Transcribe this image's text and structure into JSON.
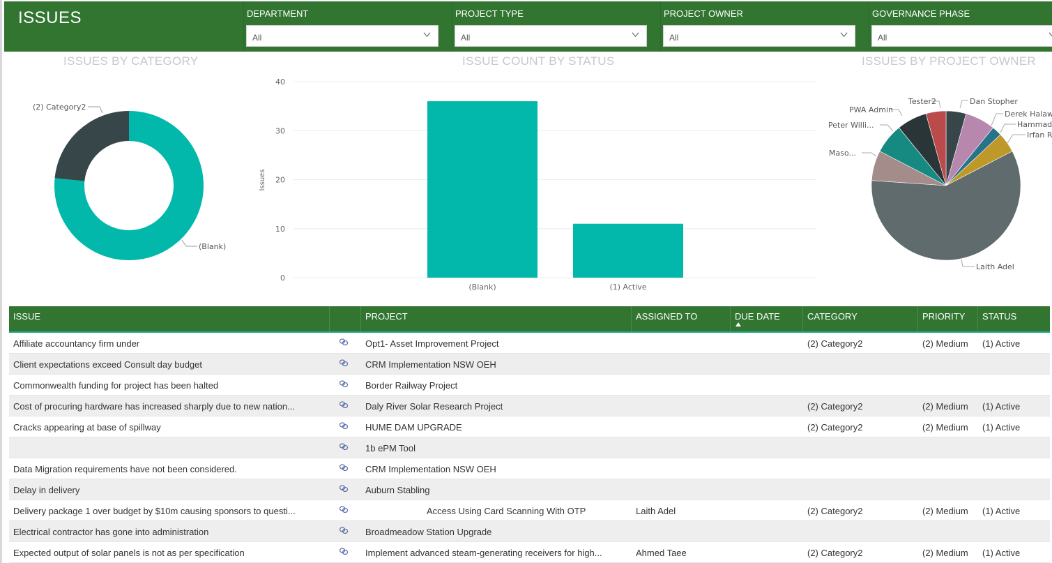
{
  "header": {
    "title": "ISSUES",
    "slicers": [
      {
        "label": "DEPARTMENT",
        "value": "All"
      },
      {
        "label": "PROJECT TYPE",
        "value": "All"
      },
      {
        "label": "PROJECT OWNER",
        "value": "All"
      },
      {
        "label": "GOVERNANCE PHASE",
        "value": "All"
      }
    ]
  },
  "colors": {
    "header_green": "#317531",
    "teal": "#01B8AA",
    "dark_slate": "#374649",
    "title_gray": "#c8c8c8"
  },
  "chart_data": [
    {
      "type": "pie",
      "variant": "donut",
      "title": "ISSUES BY CATEGORY",
      "categories": [
        "(Blank)",
        "(2) Category2"
      ],
      "values": [
        36,
        11
      ],
      "colors": [
        "#01B8AA",
        "#374649"
      ]
    },
    {
      "type": "bar",
      "title": "ISSUE COUNT BY STATUS",
      "categories": [
        "(Blank)",
        "(1) Active"
      ],
      "values": [
        36,
        11
      ],
      "xlabel": "",
      "ylabel": "Issues",
      "ylim": [
        0,
        40
      ],
      "yticks": [
        0,
        10,
        20,
        30,
        40
      ],
      "grid": true,
      "color": "#01B8AA"
    },
    {
      "type": "pie",
      "title": "ISSUES BY PROJECT OWNER",
      "categories": [
        "Dan Stopher",
        "Derek Halaw",
        "Hammad",
        "Irfan R",
        "Laith Adel",
        "Maso...",
        "Peter Willi...",
        "PWA Admin",
        "Tester2"
      ],
      "values": [
        2,
        3,
        1,
        2,
        27,
        3,
        3,
        3,
        2
      ],
      "colors": [
        "#374649",
        "#B887AD",
        "#28738A",
        "#BE9828",
        "#5F6B6D",
        "#A48C8A",
        "#168980",
        "#293537",
        "#BB4A4A"
      ]
    }
  ],
  "table": {
    "columns": [
      "ISSUE",
      "",
      "PROJECT",
      "ASSIGNED TO",
      "DUE DATE",
      "CATEGORY",
      "PRIORITY",
      "STATUS"
    ],
    "sorted_column": "DUE DATE",
    "rows": [
      {
        "issue": "Affiliate accountancy firm under",
        "project": "Opt1- Asset Improvement Project",
        "assigned_to": "",
        "due_date": "",
        "category": "(2) Category2",
        "priority": "(2) Medium",
        "status": "(1) Active"
      },
      {
        "issue": "Client expectations exceed Consult day budget",
        "project": "CRM Implementation NSW OEH",
        "assigned_to": "",
        "due_date": "",
        "category": "",
        "priority": "",
        "status": ""
      },
      {
        "issue": "Commonwealth funding for project has been halted",
        "project": "Border Railway Project",
        "assigned_to": "",
        "due_date": "",
        "category": "",
        "priority": "",
        "status": ""
      },
      {
        "issue": "Cost of procuring hardware has increased sharply due to new nation...",
        "project": "Daly River Solar Research Project",
        "assigned_to": "",
        "due_date": "",
        "category": "(2) Category2",
        "priority": "(2) Medium",
        "status": "(1) Active"
      },
      {
        "issue": "Cracks appearing at base of spillway",
        "project": "HUME DAM UPGRADE",
        "assigned_to": "",
        "due_date": "",
        "category": "(2) Category2",
        "priority": "(2) Medium",
        "status": "(1) Active"
      },
      {
        "issue": "",
        "project": "1b ePM Tool",
        "assigned_to": "",
        "due_date": "",
        "category": "",
        "priority": "",
        "status": ""
      },
      {
        "issue": "Data Migration requirements have not been considered.",
        "project": "CRM Implementation NSW OEH",
        "assigned_to": "",
        "due_date": "",
        "category": "",
        "priority": "",
        "status": ""
      },
      {
        "issue": "Delay in delivery",
        "project": "Auburn Stabling",
        "assigned_to": "",
        "due_date": "",
        "category": "",
        "priority": "",
        "status": ""
      },
      {
        "issue": "Delivery package 1 over budget by $10m causing sponsors to questi...",
        "project": "Access Using Card Scanning With OTP",
        "assigned_to": "Laith Adel",
        "due_date": "",
        "category": "(2) Category2",
        "priority": "(2) Medium",
        "status": "(1) Active"
      },
      {
        "issue": "Electrical contractor has gone into administration",
        "project": "Broadmeadow Station Upgrade",
        "assigned_to": "",
        "due_date": "",
        "category": "",
        "priority": "",
        "status": ""
      },
      {
        "issue": "Expected output of solar panels is not as per specification",
        "project": "Implement advanced steam-generating receivers for high...",
        "assigned_to": "Ahmed Taee",
        "due_date": "",
        "category": "(2) Category2",
        "priority": "(2) Medium",
        "status": "(1) Active"
      }
    ]
  }
}
